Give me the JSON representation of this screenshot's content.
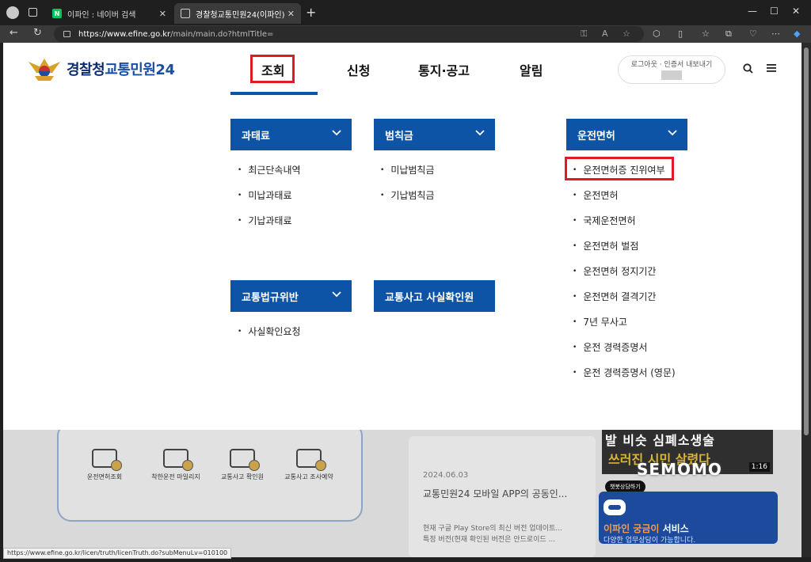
{
  "browser": {
    "tabs": [
      {
        "title": "이파인 : 네이버 검색",
        "favicon": "N",
        "active": false
      },
      {
        "title": "경찰청교통민원24(이파인)",
        "active": true
      }
    ],
    "url_host": "https://www.efine.go.kr",
    "url_path": "/main/main.do?htmlTitle="
  },
  "header": {
    "logo_part1": "경찰청",
    "logo_part2": "교통민원24",
    "nav": [
      "조회",
      "신청",
      "통지·공고",
      "알림"
    ],
    "util_text_1": "로그아웃 · 인증서 내보내기"
  },
  "menu": {
    "groups": [
      {
        "title": "과태료",
        "items": [
          "최근단속내역",
          "미납과태료",
          "기납과태료"
        ]
      },
      {
        "title": "범칙금",
        "items": [
          "미납범칙금",
          "기납범칙금"
        ]
      },
      {
        "title": "운전면허",
        "items": [
          "운전면허증 진위여부",
          "운전면허",
          "국제운전면허",
          "운전면허 벌점",
          "운전면허 정지기간",
          "운전면허 결격기간",
          "7년 무사고",
          "운전 경력증명서",
          "운전 경력증명서 (영문)"
        ]
      },
      {
        "title": "교통법규위반",
        "items": [
          "사실확인요청"
        ]
      },
      {
        "title": "교통사고 사실확인원",
        "items": []
      }
    ]
  },
  "background": {
    "services": [
      "운전면허조회",
      "착한운전 마일리지",
      "교통사고 확인원",
      "교통사고 조사예약"
    ],
    "news_date": "2024.06.03",
    "news_title": "교통민원24 모바일 APP의 공동인...",
    "news_body_1": "현재 구글 Play Store의 최신 버전 업데이트...",
    "news_body_2": "특정 버전(현재 확인된 버전은 안드로이드 ...",
    "video_text_1": "발 비슷 심폐소생술",
    "video_text_2": "쓰러진 시민 살렸다",
    "video_duration": "1:16",
    "watermark": "SEMOMO",
    "chat_tooltip": "챗봇상담하기",
    "chat_title_accent": "이파인 궁금이",
    "chat_title_rest": " 서비스",
    "chat_sub": "다양한 업무상담이 가능합니다."
  },
  "status_url": "https://www.efine.go.kr/licen/truth/licenTruth.do?subMenuLv=010100",
  "colors": {
    "brand_blue": "#0d54a6",
    "highlight_red": "#e01b24",
    "navy": "#0d2c6b"
  }
}
